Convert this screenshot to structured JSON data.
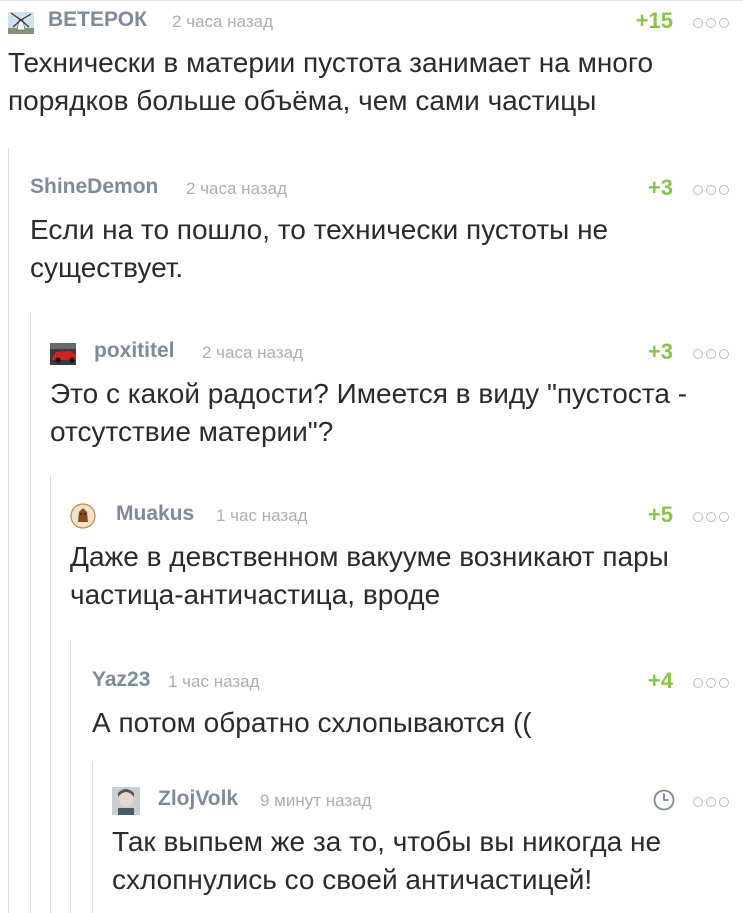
{
  "comments": [
    {
      "author": "ВЕТЕРОК",
      "time": "2 часа назад",
      "rating": "+15",
      "avatar": "windmill-avatar",
      "text": "Технически в материи пустота занимает на много порядков больше объёма, чем сами частицы"
    },
    {
      "author": "ShineDemon",
      "time": "2 часа назад",
      "rating": "+3",
      "text": "Если на то пошло, то технически пустоты не существует."
    },
    {
      "author": "poxititel",
      "time": "2 часа назад",
      "rating": "+3",
      "avatar": "red-car-avatar",
      "text": "Это с какой радости? Имеется в виду \"пустоста - отсутствие материи\"?"
    },
    {
      "author": "Muakus",
      "time": "1 час назад",
      "rating": "+5",
      "avatar": "badge-avatar",
      "text": "Даже в девственном вакууме возникают пары частица-античастица, вроде"
    },
    {
      "author": "Yaz23",
      "time": "1 час назад",
      "rating": "+4",
      "text": "А потом обратно схлопываются (("
    },
    {
      "author": "ZlojVolk",
      "time": "9 минут назад",
      "rating_icon": "clock-icon",
      "avatar": "portrait-avatar",
      "text": "Так выпьем же за то, чтобы вы никогда не схлопнулись со своей античастицей!"
    }
  ],
  "colors": {
    "author": "#7f8b9a",
    "time": "#a9afb5",
    "rating": "#8bc34a",
    "text": "#2b2b2b",
    "thread_line": "#dcdcdc"
  },
  "icons": {
    "more": "more-dots-icon",
    "pending_rating": "clock-icon"
  }
}
